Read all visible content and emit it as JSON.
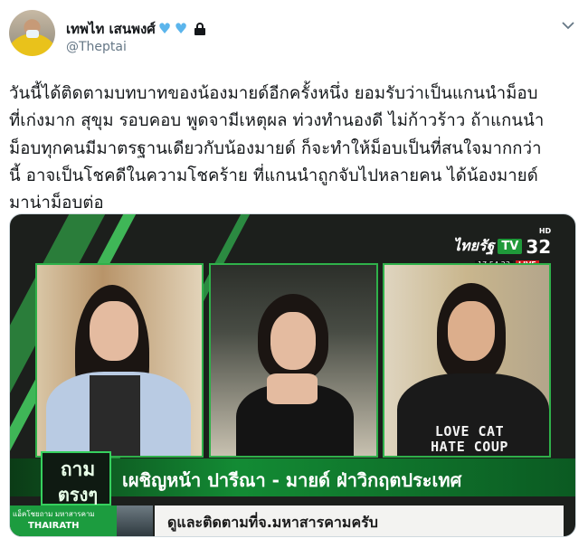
{
  "user": {
    "display_name": "เทพไท เสนพงศ์",
    "handle": "@Theptai",
    "badges": [
      "blue-heart-icon",
      "blue-heart-icon",
      "lock-icon"
    ]
  },
  "tweet": {
    "lines": [
      "วันนี้ได้ติดตามบทบาทของน้องมายด์อีกครั้งหนึ่ง ยอมรับว่าเป็นแกนนำม็อบ",
      "ที่เก่งมาก สุขุม รอบคอบ พูดจามีเหตุผล ท่วงทำนองดี ไม่ก้าวร้าว ถ้าแกนนำ",
      "ม็อบทุกคนมีมาตรฐานเดียวกับน้องมายด์ ก็จะทำให้ม็อบเป็นที่สนใจมากกว่า",
      "นี้ อาจเป็นโชคดีในความโชคร้าย ที่แกนนำถูกจับไปหลายคน ได้น้องมายด์",
      "มาน่าม็อบต่อ"
    ]
  },
  "media": {
    "channel_name": "ไทยรัฐ",
    "channel_tv": "TV",
    "channel_number": "32",
    "hd_label": "HD",
    "clock": "17:54:23",
    "live_label": "LIVE",
    "show_logo_line1": "ถาม",
    "show_logo_line2": "ตรงๆ",
    "headline": "เผชิญหน้า ปารีณา - มายด์ ฝ่าวิกฤตประเทศ",
    "ticker_tag_line1": "แอ็คโชยถาม มหาสารคาม",
    "ticker_tag_line2": "THAIRATH",
    "subline": "ดูและติดตามที่จ.มหาสารคามครับ",
    "shirt_text_line1": "LOVE CAT",
    "shirt_text_line2": "HATE COUP"
  },
  "colors": {
    "heart": "#5bb5ec",
    "accent_green": "#2fb14a",
    "handle_gray": "#657786"
  }
}
